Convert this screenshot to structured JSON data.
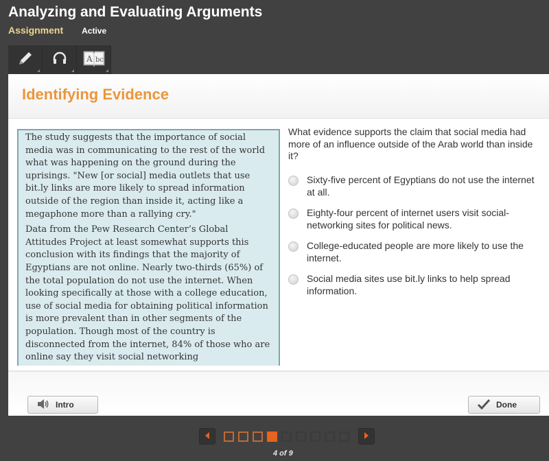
{
  "header": {
    "title": "Analyzing and Evaluating Arguments",
    "type_label": "Assignment",
    "status": "Active"
  },
  "toolbar": {
    "tools": [
      {
        "icon": "pencil-icon"
      },
      {
        "icon": "headphones-icon"
      },
      {
        "icon": "dictionary-icon",
        "glyph_text": "Abc"
      }
    ]
  },
  "section": {
    "title": "Identifying Evidence"
  },
  "passage": {
    "paragraphs": [
      "The study suggests that the importance of social media was in communicating to the rest of the world what was happening on the ground during the uprisings. \"New [or social] media outlets that use bit.ly links are more likely to spread information outside of the region than inside it, acting like a megaphone more than a rallying cry.\"",
      "Data from the Pew Research Center’s Global Attitudes Project at least somewhat supports this conclusion with its findings that the majority of Egyptians are not online. Nearly two-thirds (65%) of the total population do not use the internet. When looking specifically at those with a college education, use of social media for obtaining political information is more prevalent than in other segments of the population. Though most of the country is disconnected from the internet, 84% of those who are online say they visit social networking"
    ]
  },
  "question": {
    "prompt": "What evidence supports the claim that social media had more of an influence outside of the Arab world than inside it?",
    "options": [
      {
        "label": "Sixty-five percent of Egyptians do not use the internet at all.",
        "selected": false
      },
      {
        "label": "Eighty-four percent of internet users visit social-networking sites for political news.",
        "selected": false
      },
      {
        "label": "College-educated people are more likely to use the internet.",
        "selected": false
      },
      {
        "label": "Social media sites use bit.ly links to help spread information.",
        "selected": false
      }
    ]
  },
  "footer": {
    "intro_label": "Intro",
    "done_label": "Done"
  },
  "pager": {
    "current": 4,
    "total": 9,
    "label": "4 of 9",
    "accent": "#e8631d"
  }
}
